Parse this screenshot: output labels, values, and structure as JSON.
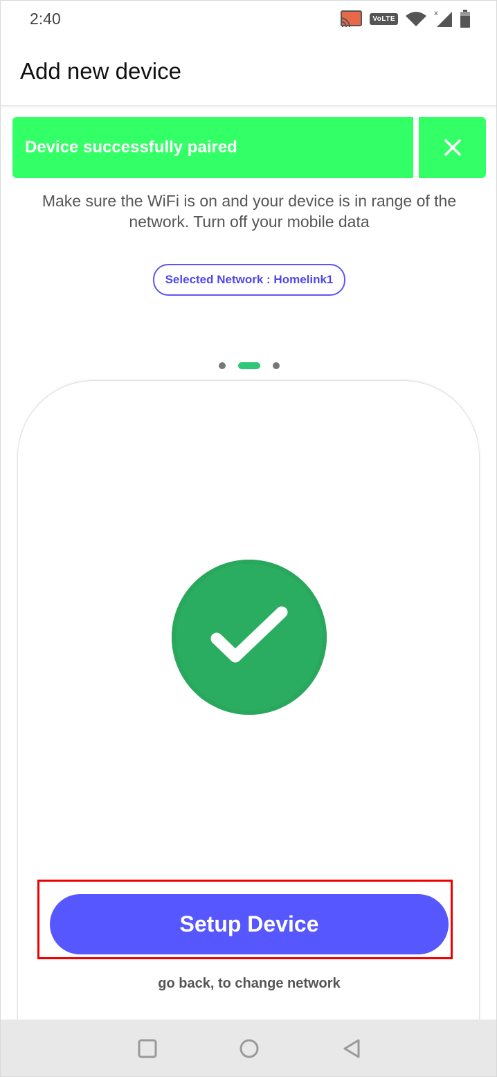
{
  "status_bar": {
    "time": "2:40",
    "volte": "VoLTE",
    "icons": [
      "cast-icon",
      "volte-icon",
      "wifi-icon",
      "signal-icon",
      "battery-icon"
    ]
  },
  "header": {
    "title": "Add new device"
  },
  "toast": {
    "message": "Device successfully paired",
    "close_icon": "close-icon",
    "color": "#33ff66"
  },
  "instructions": "Make sure the WiFi is on and your device is in range of the network. Turn off your mobile data",
  "network": {
    "label": "Selected Network : Homelink1"
  },
  "pager": {
    "count": 3,
    "active_index": 1
  },
  "card": {
    "status_icon": "check-circle-icon",
    "success_color": "#2aad60"
  },
  "actions": {
    "setup_label": "Setup Device",
    "back_label": "go back, to change network",
    "button_color": "#5757ff"
  },
  "nav_bar": {
    "buttons": [
      "recent-apps-icon",
      "home-icon",
      "back-icon"
    ]
  }
}
